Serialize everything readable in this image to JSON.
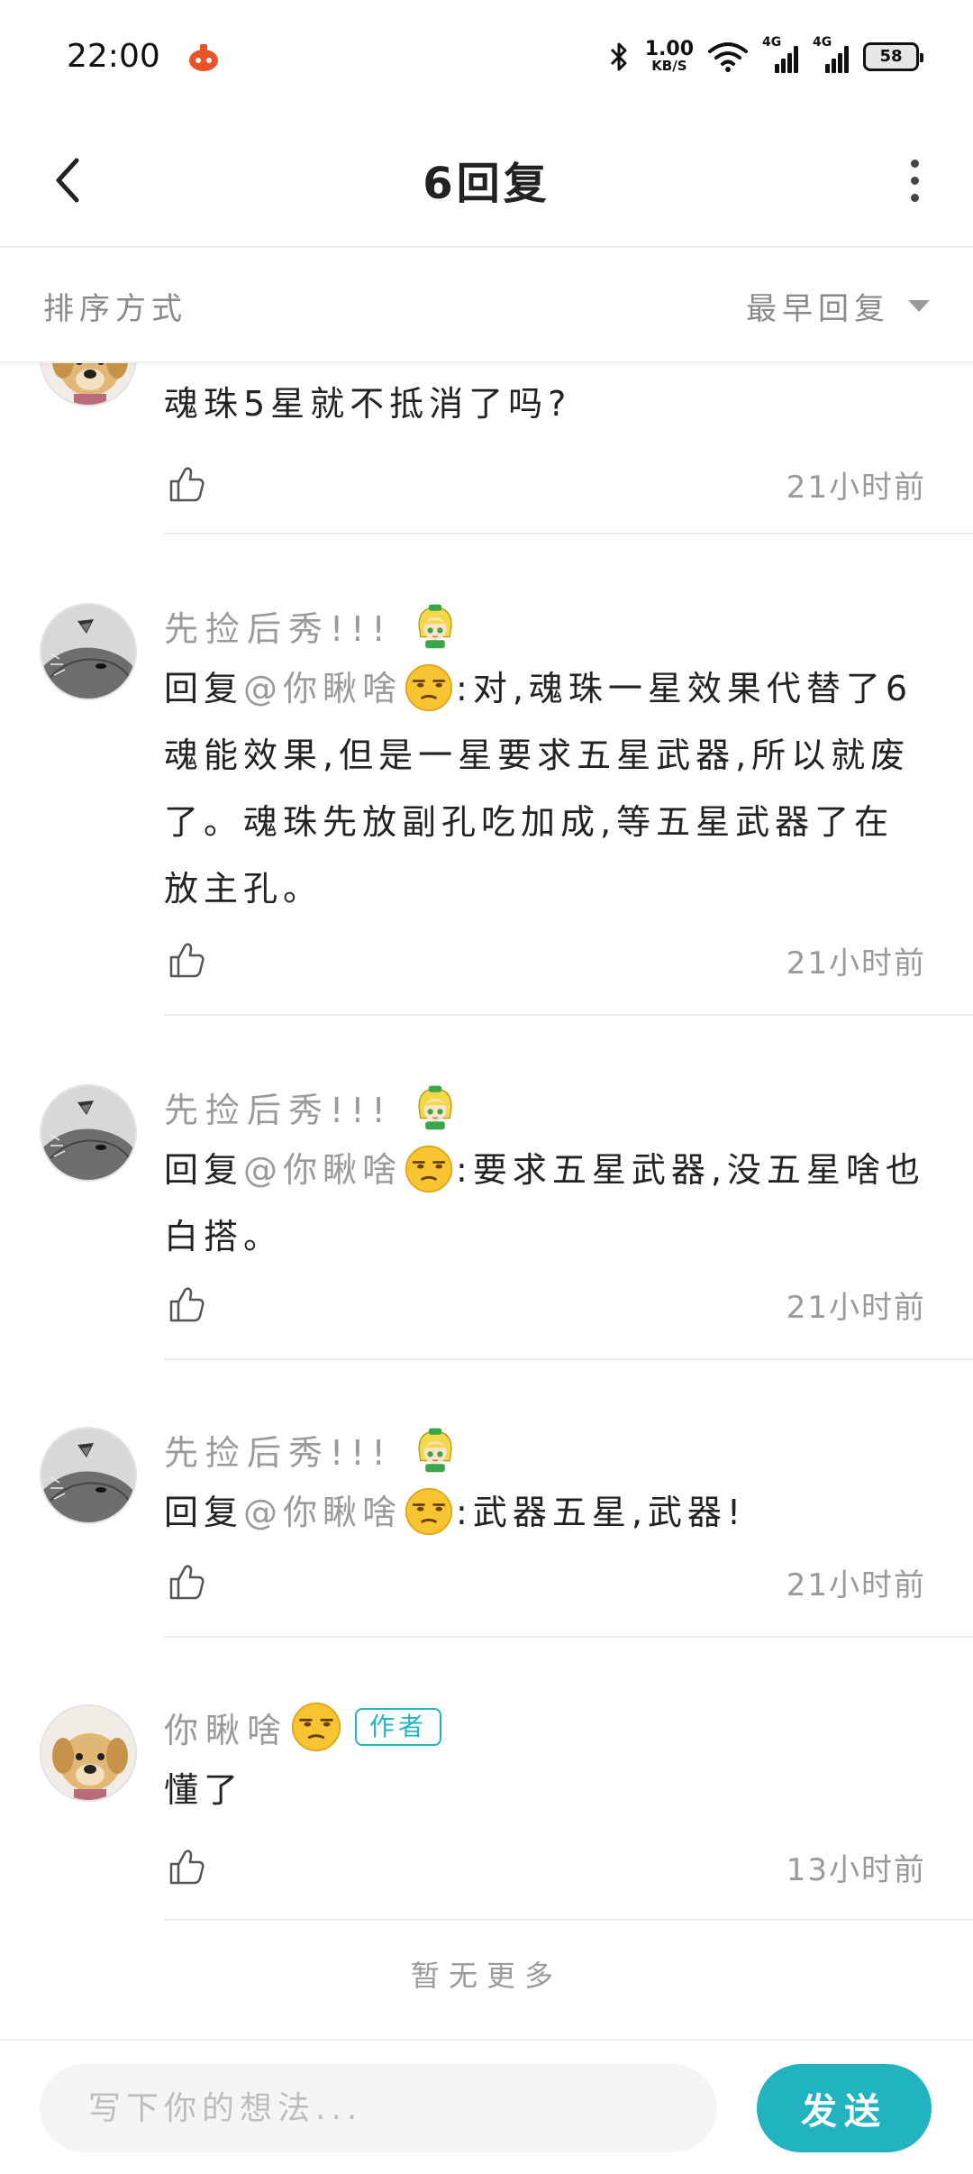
{
  "status_bar": {
    "time": "22:00",
    "net_speed_value": "1.00",
    "net_speed_unit": "KB/S",
    "sim1_label": "4G",
    "sim2_label": "4G",
    "battery": "58"
  },
  "header": {
    "title": "6回复"
  },
  "sort": {
    "label": "排序方式",
    "selected": "最早回复"
  },
  "replies": [
    {
      "text": "魂珠5星就不抵消了吗?",
      "time": "21小时前"
    },
    {
      "name": "先捡后秀!!!",
      "reply_prefix": "回复",
      "mention": "@你瞅啥",
      "text_after": ":对,魂珠一星效果代替了6魂能效果,但是一星要求五星武器,所以就废了。魂珠先放副孔吃加成,等五星武器了在放主孔。",
      "time": "21小时前"
    },
    {
      "name": "先捡后秀!!!",
      "reply_prefix": "回复",
      "mention": "@你瞅啥",
      "text_after": ":要求五星武器,没五星啥也白搭。",
      "time": "21小时前"
    },
    {
      "name": "先捡后秀!!!",
      "reply_prefix": "回复",
      "mention": "@你瞅啥",
      "text_after": ":武器五星,武器!",
      "time": "21小时前"
    },
    {
      "name": "你瞅啥",
      "badge": "作者",
      "text": "懂了",
      "time": "13小时前"
    }
  ],
  "footer_note": "暂无更多",
  "composer": {
    "placeholder": "写下你的想法...",
    "send_label": "发送"
  },
  "colors": {
    "accent": "#22b3c1",
    "muted_text": "#9a9a9a",
    "divider": "#ececec"
  },
  "icons": {
    "back": "chevron-left-icon",
    "more": "more-vertical-icon",
    "like": "thumbs-up-icon",
    "sort_caret": "caret-down-icon"
  }
}
